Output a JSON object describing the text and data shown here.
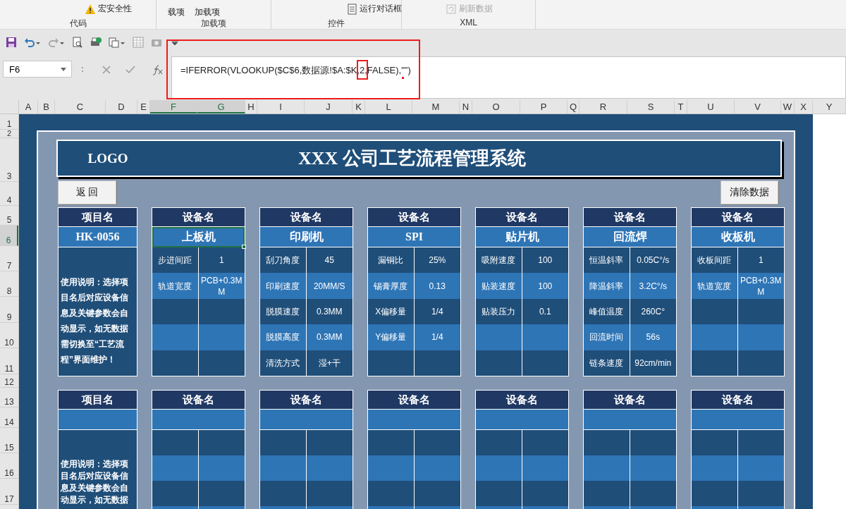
{
  "ribbon": {
    "groups": [
      {
        "label": "代码",
        "items": [
          {
            "label": "宏安全性",
            "kind": "warning",
            "disabled": false
          }
        ]
      },
      {
        "label": "加载项",
        "items": [
          {
            "label": "载项",
            "kind": "text",
            "disabled": false
          },
          {
            "label": "加载项",
            "kind": "text",
            "disabled": false
          }
        ]
      },
      {
        "label": "控件",
        "items": [
          {
            "label": "运行对话框",
            "kind": "dialog",
            "disabled": false
          }
        ]
      },
      {
        "label": "XML",
        "items": [
          {
            "label": "刷新数据",
            "kind": "refresh",
            "disabled": true
          }
        ]
      }
    ]
  },
  "formula_bar": {
    "name_box": "F6",
    "formula": "=IFERROR(VLOOKUP($C$6,数据源!$A:$K,2,FALSE),\"\")"
  },
  "columns": [
    {
      "label": "A",
      "selected": false
    },
    {
      "label": "B",
      "selected": false
    },
    {
      "label": "C",
      "selected": false
    },
    {
      "label": "D",
      "selected": false
    },
    {
      "label": "E",
      "selected": false
    },
    {
      "label": "F",
      "selected": true
    },
    {
      "label": "G",
      "selected": true
    },
    {
      "label": "H",
      "selected": false
    },
    {
      "label": "I",
      "selected": false
    },
    {
      "label": "J",
      "selected": false
    },
    {
      "label": "K",
      "selected": false
    },
    {
      "label": "L",
      "selected": false
    },
    {
      "label": "M",
      "selected": false
    },
    {
      "label": "N",
      "selected": false
    },
    {
      "label": "O",
      "selected": false
    },
    {
      "label": "P",
      "selected": false
    },
    {
      "label": "Q",
      "selected": false
    },
    {
      "label": "R",
      "selected": false
    },
    {
      "label": "S",
      "selected": false
    },
    {
      "label": "T",
      "selected": false
    },
    {
      "label": "U",
      "selected": false
    },
    {
      "label": "V",
      "selected": false
    },
    {
      "label": "W",
      "selected": false
    },
    {
      "label": "X",
      "selected": false
    },
    {
      "label": "Y",
      "selected": false
    }
  ],
  "rows": [
    {
      "label": "1",
      "selected": false
    },
    {
      "label": "2",
      "selected": false
    },
    {
      "label": "3",
      "selected": false
    },
    {
      "label": "4",
      "selected": false
    },
    {
      "label": "5",
      "selected": false
    },
    {
      "label": "6",
      "selected": true
    },
    {
      "label": "7",
      "selected": false
    },
    {
      "label": "8",
      "selected": false
    },
    {
      "label": "9",
      "selected": false
    },
    {
      "label": "10",
      "selected": false
    },
    {
      "label": "11",
      "selected": false
    },
    {
      "label": "12",
      "selected": false
    },
    {
      "label": "13",
      "selected": false
    },
    {
      "label": "14",
      "selected": false
    },
    {
      "label": "15",
      "selected": false
    },
    {
      "label": "16",
      "selected": false
    },
    {
      "label": "17",
      "selected": false
    }
  ],
  "title": {
    "logo": "LOGO",
    "text": "XXX 公司工艺流程管理系统"
  },
  "buttons": [
    {
      "label": "返 回"
    },
    {
      "label": "清除数据"
    }
  ],
  "sections": [
    {
      "project": {
        "header": "项目名",
        "value": "HK-0056",
        "note": "使用说明：选择项目名后对应设备信息及关键参数会自动显示，如无数据需切换至“工艺流程”界面维护！"
      },
      "equipment": [
        {
          "header": "设备名",
          "name": "上板机",
          "selected": true,
          "params": [
            {
              "label": "步进间距",
              "value": "1"
            },
            {
              "label": "轨道宽度",
              "value": "PCB+0.3MM"
            }
          ]
        },
        {
          "header": "设备名",
          "name": "印刷机",
          "selected": false,
          "params": [
            {
              "label": "刮刀角度",
              "value": "45"
            },
            {
              "label": "印刷速度",
              "value": "20MM/S"
            },
            {
              "label": "脱膜速度",
              "value": "0.3MM"
            },
            {
              "label": "脱膜高度",
              "value": "0.3MM"
            },
            {
              "label": "清洗方式",
              "value": "湿+干"
            }
          ]
        },
        {
          "header": "设备名",
          "name": "SPI",
          "selected": false,
          "params": [
            {
              "label": "漏铜比",
              "value": "25%"
            },
            {
              "label": "锡膏厚度",
              "value": "0.13"
            },
            {
              "label": "X偏移量",
              "value": "1/4"
            },
            {
              "label": "Y偏移量",
              "value": "1/4"
            }
          ]
        },
        {
          "header": "设备名",
          "name": "贴片机",
          "selected": false,
          "params": [
            {
              "label": "吸附速度",
              "value": "100"
            },
            {
              "label": "贴装速度",
              "value": "100"
            },
            {
              "label": "贴装压力",
              "value": "0.1"
            }
          ]
        },
        {
          "header": "设备名",
          "name": "回流焊",
          "selected": false,
          "params": [
            {
              "label": "恒温斜率",
              "value": "0.05C°/s"
            },
            {
              "label": "降温斜率",
              "value": "3.2C°/s"
            },
            {
              "label": "峰值温度",
              "value": "260C°"
            },
            {
              "label": "回流时间",
              "value": "56s"
            },
            {
              "label": "链条速度",
              "value": "92cm/min"
            }
          ]
        },
        {
          "header": "设备名",
          "name": "收板机",
          "selected": false,
          "params": [
            {
              "label": "收板间距",
              "value": "1"
            },
            {
              "label": "轨道宽度",
              "value": "PCB+0.3MM"
            }
          ]
        }
      ]
    },
    {
      "project": {
        "header": "项目名",
        "note": "使用说明：选择项目名后对应设备信息及关键参数会自动显示，如无数据"
      },
      "equipment": [
        {
          "header": "设备名",
          "selected": false
        },
        {
          "header": "设备名",
          "selected": false
        },
        {
          "header": "设备名",
          "selected": false
        },
        {
          "header": "设备名",
          "selected": false
        },
        {
          "header": "设备名",
          "selected": false
        },
        {
          "header": "设备名",
          "selected": false
        }
      ]
    }
  ]
}
